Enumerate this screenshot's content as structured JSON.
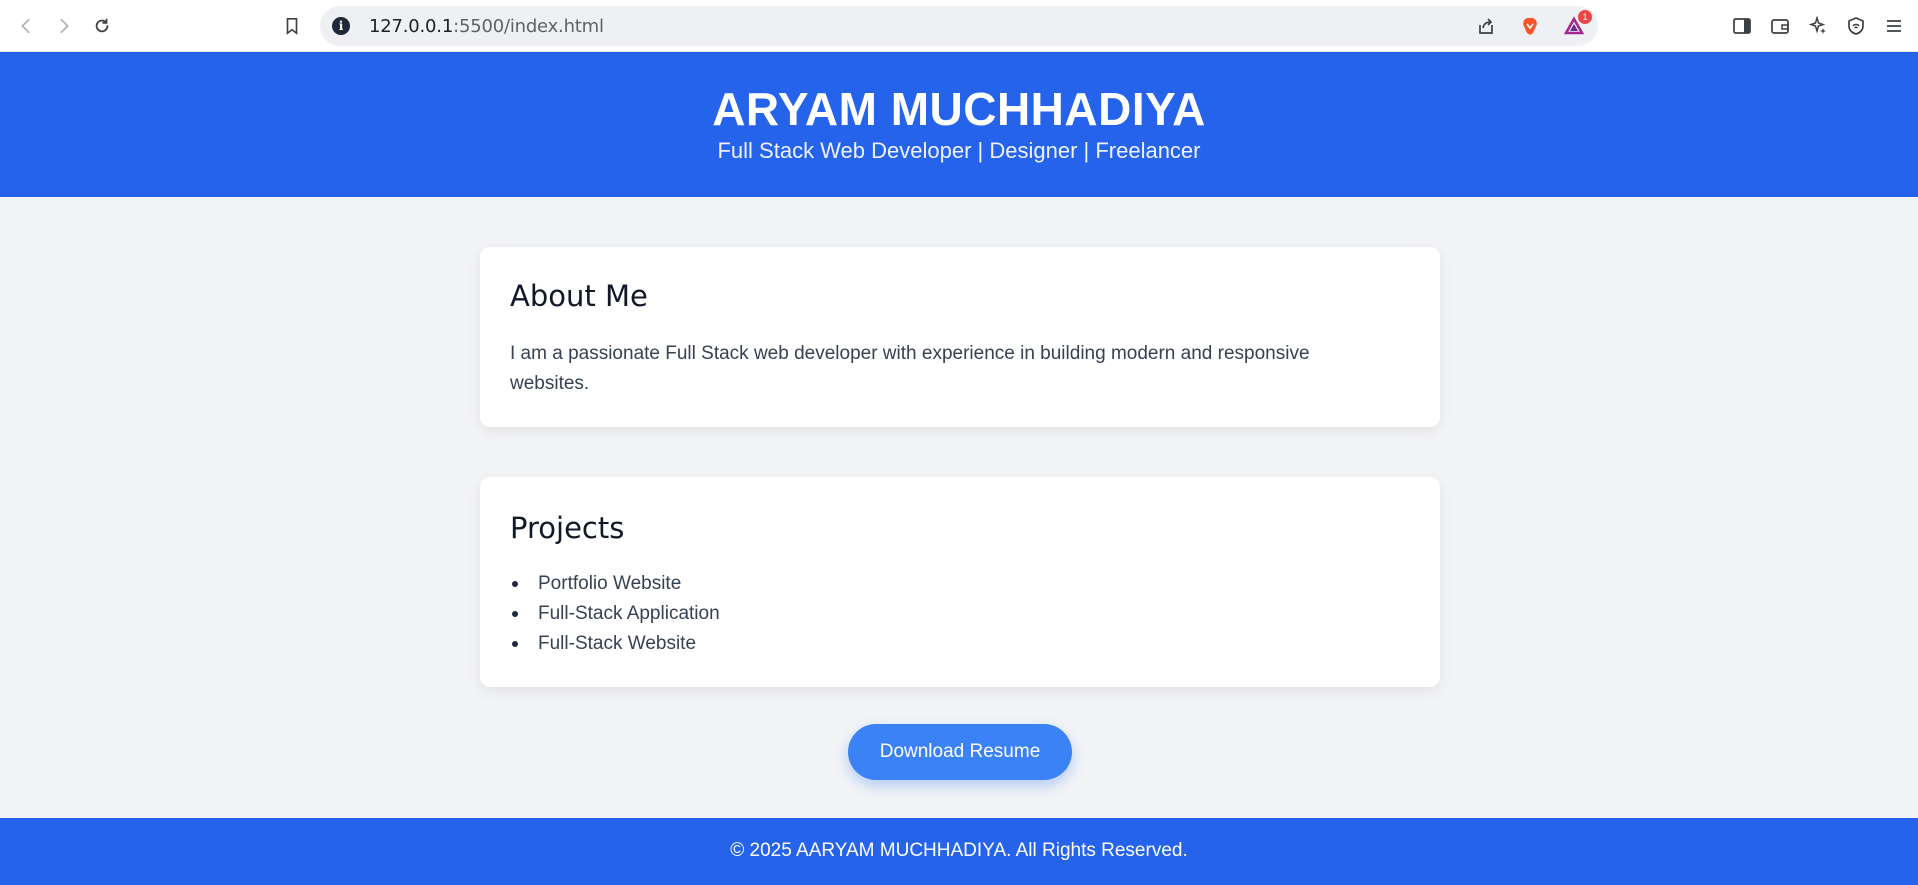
{
  "browser": {
    "url_host": "127.0.0.1",
    "url_rest": ":5500/index.html",
    "notification_count": "1"
  },
  "hero": {
    "name": "ARYAM MUCHHADIYA",
    "tagline": "Full Stack Web Developer | Designer | Freelancer"
  },
  "about": {
    "heading": "About Me",
    "text": "I am a passionate Full Stack web developer with experience in building modern and responsive websites."
  },
  "projects": {
    "heading": "Projects",
    "items": [
      "Portfolio Website",
      "Full-Stack Application",
      "Full-Stack Website"
    ]
  },
  "actions": {
    "download_label": "Download Resume"
  },
  "footer": {
    "text": "© 2025 AARYAM MUCHHADIYA. All Rights Reserved."
  },
  "colors": {
    "primary": "#2563eb",
    "button": "#3b82f6",
    "background": "#f3f4f6"
  },
  "icons": [
    "back-icon",
    "forward-icon",
    "reload-icon",
    "bookmark-icon",
    "info-icon",
    "share-icon",
    "brave-shield-icon",
    "brave-rewards-icon",
    "sidebar-icon",
    "wallet-icon",
    "leo-ai-icon",
    "vpn-icon",
    "menu-icon"
  ]
}
